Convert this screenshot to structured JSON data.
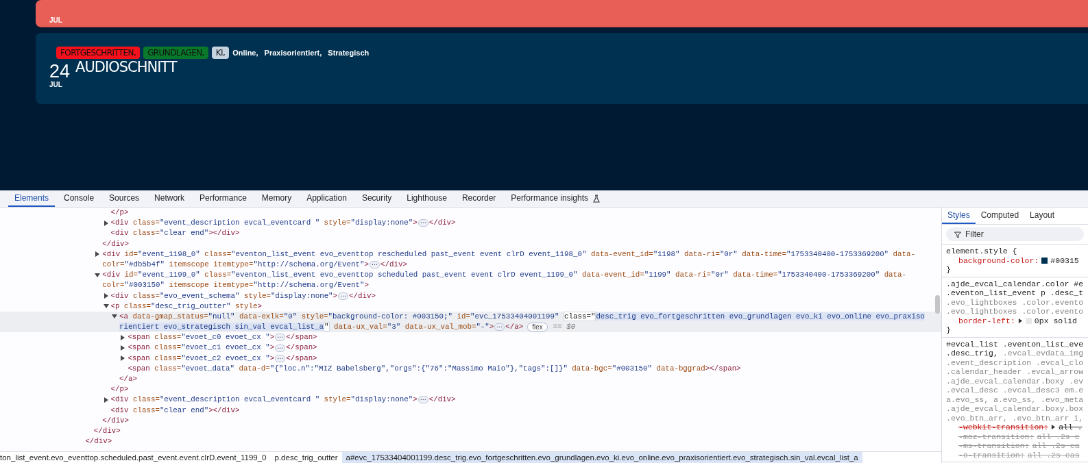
{
  "page": {
    "events": [
      {
        "kind": "partial",
        "color": "#e85f58",
        "month": "JUL"
      },
      {
        "kind": "full",
        "color": "#003150",
        "day": "24",
        "month": "JUL",
        "title": "AUDIOSCHNITT",
        "tags": [
          {
            "kind": "tag",
            "text": "FORTGESCHRITTEN,",
            "color": "#f4111b"
          },
          {
            "kind": "tag",
            "text": "GRUNDLAGEN,",
            "color": "#08792b"
          },
          {
            "kind": "tag",
            "text": "KI,",
            "color": "#c5d3de"
          },
          {
            "kind": "plain",
            "text": "Online,"
          },
          {
            "kind": "plain",
            "text": "Praxisorientiert,"
          },
          {
            "kind": "plain",
            "text": "Strategisch"
          }
        ]
      }
    ]
  },
  "devtools": {
    "tabs": [
      {
        "kind": "plain",
        "label": "Elements",
        "selected": true
      },
      {
        "kind": "plain",
        "label": "Console",
        "selected": false
      },
      {
        "kind": "plain",
        "label": "Sources",
        "selected": false
      },
      {
        "kind": "plain",
        "label": "Network",
        "selected": false
      },
      {
        "kind": "plain",
        "label": "Performance",
        "selected": false
      },
      {
        "kind": "plain",
        "label": "Memory",
        "selected": false
      },
      {
        "kind": "plain",
        "label": "Application",
        "selected": false
      },
      {
        "kind": "plain",
        "label": "Security",
        "selected": false
      },
      {
        "kind": "plain",
        "label": "Lighthouse",
        "selected": false
      },
      {
        "kind": "plain",
        "label": "Recorder",
        "selected": false
      },
      {
        "kind": "experimental",
        "label": "Performance insights",
        "selected": false
      }
    ],
    "dom": [
      {
        "kind": "continued",
        "children": [
          {
            "kind": "continued",
            "children": [
              {
                "kind": "continued",
                "children": [
                  {
                    "kind": "leaf",
                    "selected": false,
                    "lines": [
                      [
                        {
                          "kind": "code",
                          "tokens": [
                            {
                              "kind": "tag",
                              "text": "</p>"
                            }
                          ]
                        }
                      ]
                    ]
                  },
                  {
                    "kind": "parent",
                    "expanded": false,
                    "selected": false,
                    "lines": [
                      [
                        {
                          "kind": "code",
                          "tokens": [
                            {
                              "kind": "tag",
                              "text": "<div"
                            },
                            {
                              "kind": "attr",
                              "text": " class="
                            },
                            {
                              "kind": "value",
                              "text": "\"event_description evcal_eventcard \""
                            },
                            {
                              "kind": "attr",
                              "text": " style="
                            },
                            {
                              "kind": "value",
                              "text": "\"display:none\""
                            },
                            {
                              "kind": "tag",
                              "text": ">"
                            }
                          ]
                        },
                        {
                          "kind": "more",
                          "text": "⋯"
                        },
                        {
                          "kind": "code",
                          "tokens": [
                            {
                              "kind": "tag",
                              "text": "</div>"
                            }
                          ]
                        }
                      ]
                    ]
                  },
                  {
                    "kind": "leaf",
                    "selected": false,
                    "lines": [
                      [
                        {
                          "kind": "code",
                          "tokens": [
                            {
                              "kind": "tag",
                              "text": "<div"
                            },
                            {
                              "kind": "attr",
                              "text": " class="
                            },
                            {
                              "kind": "value",
                              "text": "\"clear end\""
                            },
                            {
                              "kind": "tag",
                              "text": "></div>"
                            }
                          ]
                        }
                      ]
                    ]
                  }
                ],
                "close": [
                  {
                    "kind": "tag",
                    "text": "</div>"
                  }
                ]
              },
              {
                "kind": "parent",
                "expanded": false,
                "selected": false,
                "lines": [
                  [
                    {
                      "kind": "code",
                      "tokens": [
                        {
                          "kind": "tag",
                          "text": "<div"
                        },
                        {
                          "kind": "attr",
                          "text": " id="
                        },
                        {
                          "kind": "value",
                          "text": "\"event_1198_0\""
                        },
                        {
                          "kind": "attr",
                          "text": " class="
                        },
                        {
                          "kind": "value",
                          "text": "\"eventon_list_event evo_eventtop rescheduled past_event event clrD event_1198_0\""
                        },
                        {
                          "kind": "attr",
                          "text": " data-event_id="
                        },
                        {
                          "kind": "value",
                          "text": "\"1198\""
                        },
                        {
                          "kind": "attr",
                          "text": " data-ri="
                        },
                        {
                          "kind": "value",
                          "text": "\"0r\""
                        },
                        {
                          "kind": "attr",
                          "text": " data-time="
                        },
                        {
                          "kind": "value",
                          "text": "\"1753340400-1753369200\""
                        },
                        {
                          "kind": "attr",
                          "text": " data-"
                        }
                      ]
                    }
                  ],
                  [
                    {
                      "kind": "code",
                      "tokens": [
                        {
                          "kind": "attr",
                          "text": "colr="
                        },
                        {
                          "kind": "value",
                          "text": "\"#db5b4f\""
                        },
                        {
                          "kind": "attr",
                          "text": " itemscope itemtype="
                        },
                        {
                          "kind": "value",
                          "text": "\"http://schema.org/Event\""
                        },
                        {
                          "kind": "tag",
                          "text": ">"
                        }
                      ]
                    },
                    {
                      "kind": "more",
                      "text": "⋯"
                    },
                    {
                      "kind": "code",
                      "tokens": [
                        {
                          "kind": "tag",
                          "text": "</div>"
                        }
                      ]
                    }
                  ]
                ]
              },
              {
                "kind": "parent",
                "expanded": true,
                "selected": false,
                "lines": [
                  [
                    {
                      "kind": "code",
                      "tokens": [
                        {
                          "kind": "tag",
                          "text": "<div"
                        },
                        {
                          "kind": "attr",
                          "text": " id="
                        },
                        {
                          "kind": "value",
                          "text": "\"event_1199_0\""
                        },
                        {
                          "kind": "attr",
                          "text": " class="
                        },
                        {
                          "kind": "value",
                          "text": "\"eventon_list_event evo_eventtop scheduled past_event event clrD event_1199_0\""
                        },
                        {
                          "kind": "attr",
                          "text": " data-event_id="
                        },
                        {
                          "kind": "value",
                          "text": "\"1199\""
                        },
                        {
                          "kind": "attr",
                          "text": " data-ri="
                        },
                        {
                          "kind": "value",
                          "text": "\"0r\""
                        },
                        {
                          "kind": "attr",
                          "text": " data-time="
                        },
                        {
                          "kind": "value",
                          "text": "\"1753340400-1753369200\""
                        },
                        {
                          "kind": "attr",
                          "text": " data-"
                        }
                      ]
                    }
                  ],
                  [
                    {
                      "kind": "code",
                      "tokens": [
                        {
                          "kind": "attr",
                          "text": "colr="
                        },
                        {
                          "kind": "value",
                          "text": "\"#003150\""
                        },
                        {
                          "kind": "attr",
                          "text": " itemscope itemtype="
                        },
                        {
                          "kind": "value",
                          "text": "\"http://schema.org/Event\""
                        },
                        {
                          "kind": "tag",
                          "text": ">"
                        }
                      ]
                    }
                  ]
                ],
                "children": [
                  {
                    "kind": "parent",
                    "expanded": false,
                    "selected": false,
                    "lines": [
                      [
                        {
                          "kind": "code",
                          "tokens": [
                            {
                              "kind": "tag",
                              "text": "<div"
                            },
                            {
                              "kind": "attr",
                              "text": " class="
                            },
                            {
                              "kind": "value",
                              "text": "\"evo_event_schema\""
                            },
                            {
                              "kind": "attr",
                              "text": " style="
                            },
                            {
                              "kind": "value",
                              "text": "\"display:none\""
                            },
                            {
                              "kind": "tag",
                              "text": ">"
                            }
                          ]
                        },
                        {
                          "kind": "more",
                          "text": "⋯"
                        },
                        {
                          "kind": "code",
                          "tokens": [
                            {
                              "kind": "tag",
                              "text": "</div>"
                            }
                          ]
                        }
                      ]
                    ]
                  },
                  {
                    "kind": "parent",
                    "expanded": true,
                    "selected": false,
                    "lines": [
                      [
                        {
                          "kind": "code",
                          "tokens": [
                            {
                              "kind": "tag",
                              "text": "<p"
                            },
                            {
                              "kind": "attr",
                              "text": " class="
                            },
                            {
                              "kind": "value",
                              "text": "\"desc_trig_outter\""
                            },
                            {
                              "kind": "attr",
                              "text": " style"
                            },
                            {
                              "kind": "tag",
                              "text": ">"
                            }
                          ]
                        }
                      ]
                    ],
                    "children": [
                      {
                        "kind": "parent",
                        "expanded": true,
                        "selected": true,
                        "lines": [
                          [
                            {
                              "kind": "code",
                              "tokens": [
                                {
                                  "kind": "tag",
                                  "text": "<a"
                                },
                                {
                                  "kind": "attr",
                                  "text": " data-gmap_status="
                                },
                                {
                                  "kind": "value",
                                  "text": "\"null\""
                                },
                                {
                                  "kind": "attr",
                                  "text": " data-exlk="
                                },
                                {
                                  "kind": "value",
                                  "text": "\"0\""
                                },
                                {
                                  "kind": "attr",
                                  "text": " style="
                                },
                                {
                                  "kind": "value",
                                  "text": "\"background-color: #003150;\""
                                },
                                {
                                  "kind": "attr",
                                  "text": " id="
                                },
                                {
                                  "kind": "value",
                                  "text": "\"evc_17533404001199\" "
                                },
                                {
                                  "kind": "edit",
                                  "text": "class=\""
                                },
                                {
                                  "kind": "sel",
                                  "text": "desc_trig evo_fortgeschritten evo_grundlagen evo_ki evo_online evo_praxiso"
                                }
                              ]
                            }
                          ],
                          [
                            {
                              "kind": "code",
                              "tokens": [
                                {
                                  "kind": "sel",
                                  "text": "rientiert evo_strategisch sin_val evcal_list_a"
                                },
                                {
                                  "kind": "edit",
                                  "text": "\""
                                },
                                {
                                  "kind": "attr",
                                  "text": " data-ux_val="
                                },
                                {
                                  "kind": "value",
                                  "text": "\"3\""
                                },
                                {
                                  "kind": "attr",
                                  "text": " data-ux_val_mob="
                                },
                                {
                                  "kind": "value",
                                  "text": "\"-\""
                                },
                                {
                                  "kind": "tag",
                                  "text": ">"
                                }
                              ]
                            },
                            {
                              "kind": "more",
                              "text": "⋯"
                            },
                            {
                              "kind": "code",
                              "tokens": [
                                {
                                  "kind": "tag",
                                  "text": "</a>"
                                }
                              ]
                            },
                            {
                              "kind": "badge",
                              "text": "flex"
                            },
                            {
                              "kind": "ref",
                              "text": "== $0"
                            }
                          ]
                        ],
                        "children": [
                          {
                            "kind": "parent",
                            "expanded": false,
                            "selected": false,
                            "lines": [
                              [
                                {
                                  "kind": "code",
                                  "tokens": [
                                    {
                                      "kind": "tag",
                                      "text": "<span"
                                    },
                                    {
                                      "kind": "attr",
                                      "text": " class="
                                    },
                                    {
                                      "kind": "value",
                                      "text": "\"evoet_c0 evoet_cx \""
                                    },
                                    {
                                      "kind": "tag",
                                      "text": ">"
                                    }
                                  ]
                                },
                                {
                                  "kind": "more",
                                  "text": "⋯"
                                },
                                {
                                  "kind": "code",
                                  "tokens": [
                                    {
                                      "kind": "tag",
                                      "text": "</span>"
                                    }
                                  ]
                                }
                              ]
                            ]
                          },
                          {
                            "kind": "parent",
                            "expanded": false,
                            "selected": false,
                            "lines": [
                              [
                                {
                                  "kind": "code",
                                  "tokens": [
                                    {
                                      "kind": "tag",
                                      "text": "<span"
                                    },
                                    {
                                      "kind": "attr",
                                      "text": " class="
                                    },
                                    {
                                      "kind": "value",
                                      "text": "\"evoet_c1 evoet_cx \""
                                    },
                                    {
                                      "kind": "tag",
                                      "text": ">"
                                    }
                                  ]
                                },
                                {
                                  "kind": "more",
                                  "text": "⋯"
                                },
                                {
                                  "kind": "code",
                                  "tokens": [
                                    {
                                      "kind": "tag",
                                      "text": "</span>"
                                    }
                                  ]
                                }
                              ]
                            ]
                          },
                          {
                            "kind": "parent",
                            "expanded": false,
                            "selected": false,
                            "lines": [
                              [
                                {
                                  "kind": "code",
                                  "tokens": [
                                    {
                                      "kind": "tag",
                                      "text": "<span"
                                    },
                                    {
                                      "kind": "attr",
                                      "text": " class="
                                    },
                                    {
                                      "kind": "value",
                                      "text": "\"evoet_c2 evoet_cx \""
                                    },
                                    {
                                      "kind": "tag",
                                      "text": ">"
                                    }
                                  ]
                                },
                                {
                                  "kind": "more",
                                  "text": "⋯"
                                },
                                {
                                  "kind": "code",
                                  "tokens": [
                                    {
                                      "kind": "tag",
                                      "text": "</span>"
                                    }
                                  ]
                                }
                              ]
                            ]
                          },
                          {
                            "kind": "leaf",
                            "selected": false,
                            "lines": [
                              [
                                {
                                  "kind": "code",
                                  "tokens": [
                                    {
                                      "kind": "tag",
                                      "text": "<span"
                                    },
                                    {
                                      "kind": "attr",
                                      "text": " class="
                                    },
                                    {
                                      "kind": "value",
                                      "text": "\"evoet_data\""
                                    },
                                    {
                                      "kind": "attr",
                                      "text": " data-d="
                                    },
                                    {
                                      "kind": "value",
                                      "text": "\"{\"loc.n\":\"MIZ Babelsberg\",\"orgs\":{\"76\":\"Massimo Maio\"},\"tags\":[]}\""
                                    },
                                    {
                                      "kind": "attr",
                                      "text": " data-bgc="
                                    },
                                    {
                                      "kind": "value",
                                      "text": "\"#003150\""
                                    },
                                    {
                                      "kind": "attr",
                                      "text": " data-bggrad"
                                    },
                                    {
                                      "kind": "tag",
                                      "text": "></span>"
                                    }
                                  ]
                                }
                              ]
                            ]
                          }
                        ],
                        "close": [
                          {
                            "kind": "tag",
                            "text": "</a>"
                          }
                        ]
                      }
                    ],
                    "close": [
                      {
                        "kind": "tag",
                        "text": "</p>"
                      }
                    ]
                  },
                  {
                    "kind": "parent",
                    "expanded": false,
                    "selected": false,
                    "lines": [
                      [
                        {
                          "kind": "code",
                          "tokens": [
                            {
                              "kind": "tag",
                              "text": "<div"
                            },
                            {
                              "kind": "attr",
                              "text": " class="
                            },
                            {
                              "kind": "value",
                              "text": "\"event_description evcal_eventcard \""
                            },
                            {
                              "kind": "attr",
                              "text": " style="
                            },
                            {
                              "kind": "value",
                              "text": "\"display:none\""
                            },
                            {
                              "kind": "tag",
                              "text": ">"
                            }
                          ]
                        },
                        {
                          "kind": "more",
                          "text": "⋯"
                        },
                        {
                          "kind": "code",
                          "tokens": [
                            {
                              "kind": "tag",
                              "text": "</div>"
                            }
                          ]
                        }
                      ]
                    ]
                  },
                  {
                    "kind": "leaf",
                    "selected": false,
                    "lines": [
                      [
                        {
                          "kind": "code",
                          "tokens": [
                            {
                              "kind": "tag",
                              "text": "<div"
                            },
                            {
                              "kind": "attr",
                              "text": " class="
                            },
                            {
                              "kind": "value",
                              "text": "\"clear end\""
                            },
                            {
                              "kind": "tag",
                              "text": "></div>"
                            }
                          ]
                        }
                      ]
                    ]
                  }
                ],
                "close": [
                  {
                    "kind": "tag",
                    "text": "</div>"
                  }
                ]
              }
            ],
            "close": [
              {
                "kind": "tag",
                "text": "</div>"
              }
            ]
          }
        ],
        "close": [
          {
            "kind": "tag",
            "text": "</div>"
          }
        ]
      }
    ],
    "breadcrumbs": [
      {
        "text": "ton_list_event.evo_eventtop.scheduled.past_event.event.clrD.event_1199_0",
        "selected": false
      },
      {
        "text": "p.desc_trig_outter",
        "selected": false
      },
      {
        "text": "a#evc_17533404001199.desc_trig.evo_fortgeschritten.evo_grundlagen.evo_ki.evo_online.evo_praxisorientiert.evo_strategisch.sin_val.evcal_list_a",
        "selected": true
      }
    ],
    "styles": {
      "tabs": [
        {
          "label": "Styles",
          "selected": true
        },
        {
          "label": "Computed",
          "selected": false
        },
        {
          "label": "Layout",
          "selected": false
        }
      ],
      "filter": {
        "placeholder": "Filter"
      },
      "rules": [
        {
          "selectors": [
            [
              {
                "kind": "main",
                "text": "element.style {"
              }
            ]
          ],
          "declarations": [
            {
              "prop": "background-color:",
              "value": "#00315",
              "color": "#003150",
              "expander": false,
              "struck": false,
              "dim": false
            }
          ],
          "close": "}"
        },
        {
          "selectors": [
            [
              {
                "kind": "main",
                "text": ".ajde_evcal_calendar.color #e"
              }
            ],
            [
              {
                "kind": "main",
                "text": ".eventon_list_event p .desc_t"
              }
            ],
            [
              {
                "kind": "other",
                "text": ".evo_lightboxes .color.evento"
              }
            ],
            [
              {
                "kind": "other",
                "text": ".evo_lightboxes .color.evento"
              }
            ]
          ],
          "declarations": [
            {
              "prop": "border-left:",
              "value": "0px solid",
              "expander": true,
              "color": "#e8e8e8",
              "struck": false,
              "dim": false
            }
          ],
          "close": "}"
        },
        {
          "selectors": [
            [
              {
                "kind": "main",
                "text": "#evcal_list .eventon_list_eve"
              }
            ],
            [
              {
                "kind": "main",
                "text": ".desc_trig,"
              },
              {
                "kind": "other",
                "text": " .evcal_evdata_img"
              }
            ],
            [
              {
                "kind": "other",
                "text": ".event_description .evcal_clo"
              }
            ],
            [
              {
                "kind": "other",
                "text": ".calendar_header .evcal_arrow"
              }
            ],
            [
              {
                "kind": "other",
                "text": ".ajde_evcal_calendar.boxy .ev"
              }
            ],
            [
              {
                "kind": "other",
                "text": ".evcal_desc .evcal_desc3 em.e"
              }
            ],
            [
              {
                "kind": "other",
                "text": "a.evo_ss, a.evo_ss, .evo_meta"
              }
            ],
            [
              {
                "kind": "other",
                "text": ".ajde_evcal_calendar.boxy.box"
              }
            ],
            [
              {
                "kind": "other",
                "text": ".evo_btn_arr, .evo_btn_arr i,"
              }
            ]
          ],
          "declarations": [
            {
              "prop": "-webkit-transition:",
              "value": "all .",
              "expander": true,
              "struck": true,
              "dim": false
            },
            {
              "prop": "-moz-transition:",
              "value": "all .2s e",
              "expander": false,
              "struck": true,
              "dim": true
            },
            {
              "prop": "-ms-transition:",
              "value": "all .2s ea",
              "expander": false,
              "struck": true,
              "dim": true
            },
            {
              "prop": "-o-transition:",
              "value": "all .2s eas",
              "expander": false,
              "struck": true,
              "dim": true
            }
          ]
        }
      ]
    }
  }
}
